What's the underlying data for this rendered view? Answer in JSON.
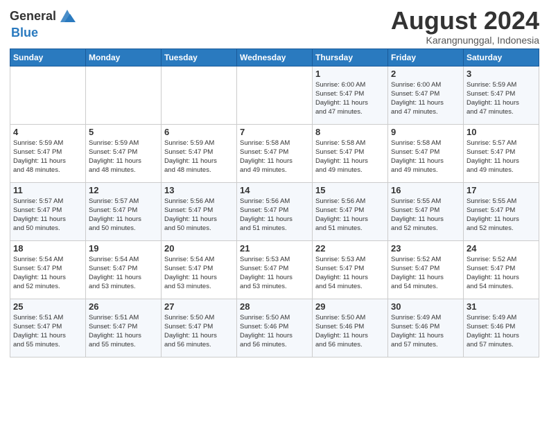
{
  "logo": {
    "line1": "General",
    "line2": "Blue"
  },
  "title": "August 2024",
  "location": "Karangnunggal, Indonesia",
  "days_of_week": [
    "Sunday",
    "Monday",
    "Tuesday",
    "Wednesday",
    "Thursday",
    "Friday",
    "Saturday"
  ],
  "weeks": [
    [
      {
        "day": "",
        "info": ""
      },
      {
        "day": "",
        "info": ""
      },
      {
        "day": "",
        "info": ""
      },
      {
        "day": "",
        "info": ""
      },
      {
        "day": "1",
        "info": "Sunrise: 6:00 AM\nSunset: 5:47 PM\nDaylight: 11 hours\nand 47 minutes."
      },
      {
        "day": "2",
        "info": "Sunrise: 6:00 AM\nSunset: 5:47 PM\nDaylight: 11 hours\nand 47 minutes."
      },
      {
        "day": "3",
        "info": "Sunrise: 5:59 AM\nSunset: 5:47 PM\nDaylight: 11 hours\nand 47 minutes."
      }
    ],
    [
      {
        "day": "4",
        "info": "Sunrise: 5:59 AM\nSunset: 5:47 PM\nDaylight: 11 hours\nand 48 minutes."
      },
      {
        "day": "5",
        "info": "Sunrise: 5:59 AM\nSunset: 5:47 PM\nDaylight: 11 hours\nand 48 minutes."
      },
      {
        "day": "6",
        "info": "Sunrise: 5:59 AM\nSunset: 5:47 PM\nDaylight: 11 hours\nand 48 minutes."
      },
      {
        "day": "7",
        "info": "Sunrise: 5:58 AM\nSunset: 5:47 PM\nDaylight: 11 hours\nand 49 minutes."
      },
      {
        "day": "8",
        "info": "Sunrise: 5:58 AM\nSunset: 5:47 PM\nDaylight: 11 hours\nand 49 minutes."
      },
      {
        "day": "9",
        "info": "Sunrise: 5:58 AM\nSunset: 5:47 PM\nDaylight: 11 hours\nand 49 minutes."
      },
      {
        "day": "10",
        "info": "Sunrise: 5:57 AM\nSunset: 5:47 PM\nDaylight: 11 hours\nand 49 minutes."
      }
    ],
    [
      {
        "day": "11",
        "info": "Sunrise: 5:57 AM\nSunset: 5:47 PM\nDaylight: 11 hours\nand 50 minutes."
      },
      {
        "day": "12",
        "info": "Sunrise: 5:57 AM\nSunset: 5:47 PM\nDaylight: 11 hours\nand 50 minutes."
      },
      {
        "day": "13",
        "info": "Sunrise: 5:56 AM\nSunset: 5:47 PM\nDaylight: 11 hours\nand 50 minutes."
      },
      {
        "day": "14",
        "info": "Sunrise: 5:56 AM\nSunset: 5:47 PM\nDaylight: 11 hours\nand 51 minutes."
      },
      {
        "day": "15",
        "info": "Sunrise: 5:56 AM\nSunset: 5:47 PM\nDaylight: 11 hours\nand 51 minutes."
      },
      {
        "day": "16",
        "info": "Sunrise: 5:55 AM\nSunset: 5:47 PM\nDaylight: 11 hours\nand 52 minutes."
      },
      {
        "day": "17",
        "info": "Sunrise: 5:55 AM\nSunset: 5:47 PM\nDaylight: 11 hours\nand 52 minutes."
      }
    ],
    [
      {
        "day": "18",
        "info": "Sunrise: 5:54 AM\nSunset: 5:47 PM\nDaylight: 11 hours\nand 52 minutes."
      },
      {
        "day": "19",
        "info": "Sunrise: 5:54 AM\nSunset: 5:47 PM\nDaylight: 11 hours\nand 53 minutes."
      },
      {
        "day": "20",
        "info": "Sunrise: 5:54 AM\nSunset: 5:47 PM\nDaylight: 11 hours\nand 53 minutes."
      },
      {
        "day": "21",
        "info": "Sunrise: 5:53 AM\nSunset: 5:47 PM\nDaylight: 11 hours\nand 53 minutes."
      },
      {
        "day": "22",
        "info": "Sunrise: 5:53 AM\nSunset: 5:47 PM\nDaylight: 11 hours\nand 54 minutes."
      },
      {
        "day": "23",
        "info": "Sunrise: 5:52 AM\nSunset: 5:47 PM\nDaylight: 11 hours\nand 54 minutes."
      },
      {
        "day": "24",
        "info": "Sunrise: 5:52 AM\nSunset: 5:47 PM\nDaylight: 11 hours\nand 54 minutes."
      }
    ],
    [
      {
        "day": "25",
        "info": "Sunrise: 5:51 AM\nSunset: 5:47 PM\nDaylight: 11 hours\nand 55 minutes."
      },
      {
        "day": "26",
        "info": "Sunrise: 5:51 AM\nSunset: 5:47 PM\nDaylight: 11 hours\nand 55 minutes."
      },
      {
        "day": "27",
        "info": "Sunrise: 5:50 AM\nSunset: 5:47 PM\nDaylight: 11 hours\nand 56 minutes."
      },
      {
        "day": "28",
        "info": "Sunrise: 5:50 AM\nSunset: 5:46 PM\nDaylight: 11 hours\nand 56 minutes."
      },
      {
        "day": "29",
        "info": "Sunrise: 5:50 AM\nSunset: 5:46 PM\nDaylight: 11 hours\nand 56 minutes."
      },
      {
        "day": "30",
        "info": "Sunrise: 5:49 AM\nSunset: 5:46 PM\nDaylight: 11 hours\nand 57 minutes."
      },
      {
        "day": "31",
        "info": "Sunrise: 5:49 AM\nSunset: 5:46 PM\nDaylight: 11 hours\nand 57 minutes."
      }
    ]
  ]
}
